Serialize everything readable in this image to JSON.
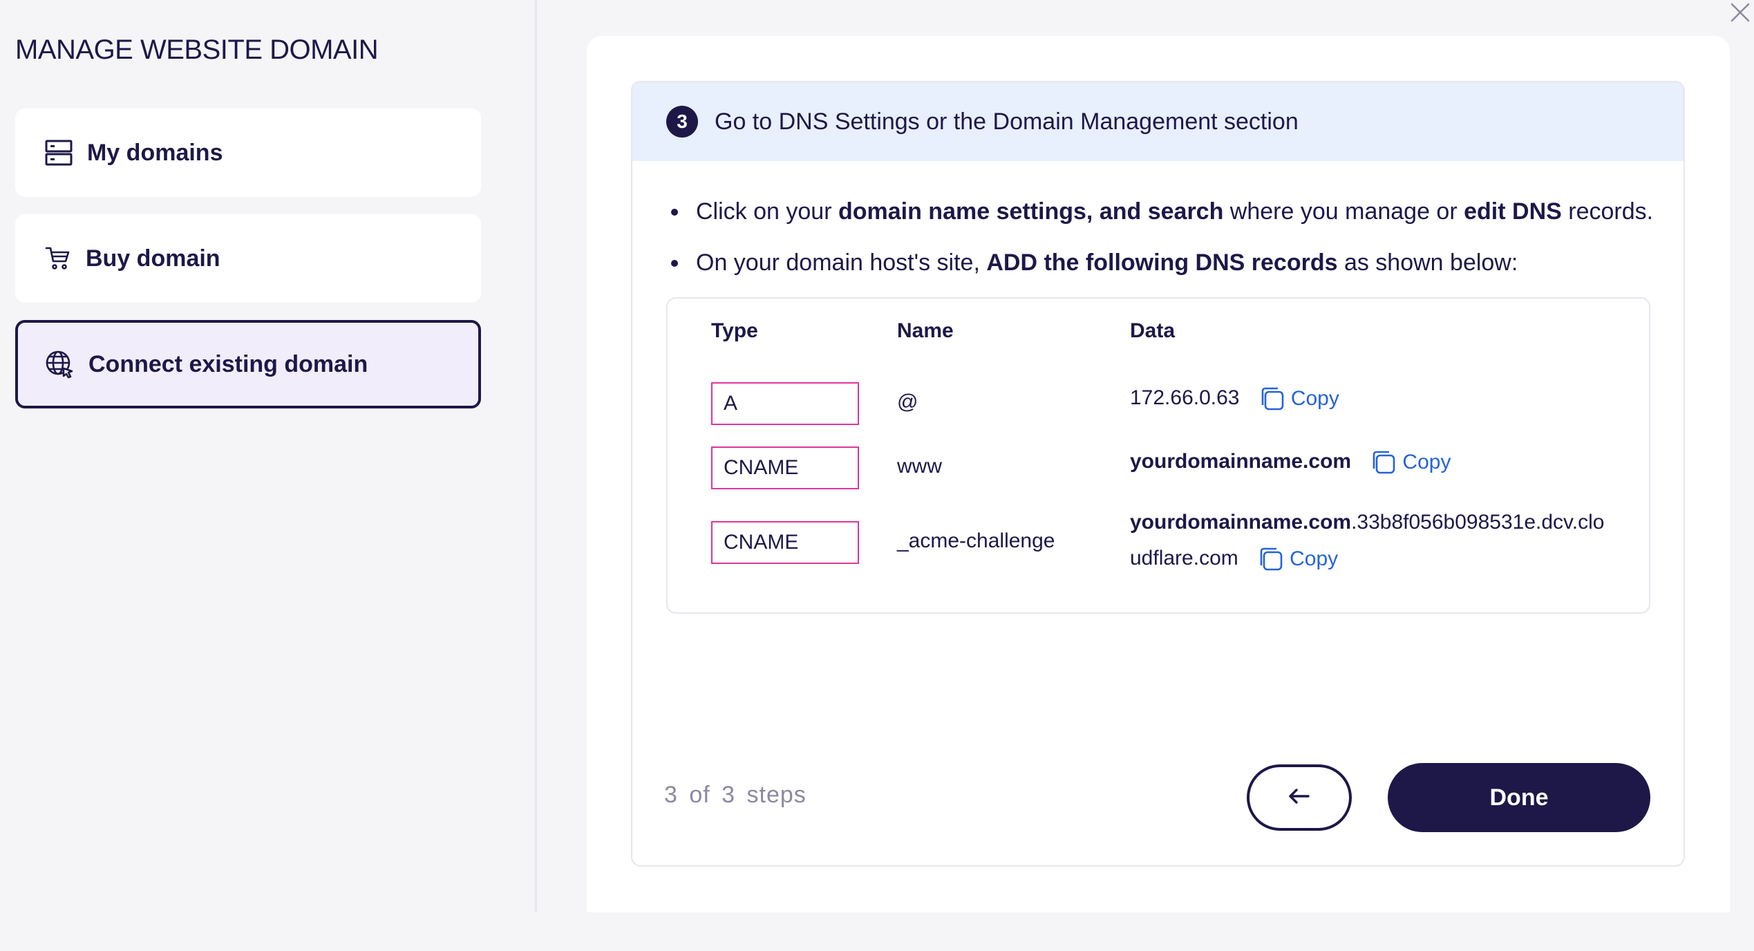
{
  "sidebar": {
    "title": "MANAGE WEBSITE DOMAIN",
    "items": [
      {
        "label": "My domains",
        "icon": "server-icon"
      },
      {
        "label": "Buy domain",
        "icon": "cart-icon"
      },
      {
        "label": "Connect existing domain",
        "icon": "globe-cursor-icon",
        "active": true
      }
    ]
  },
  "step": {
    "number": "3",
    "title": "Go to DNS Settings or the Domain Management section",
    "bullet1": {
      "t1": "Click on your ",
      "b1": "domain name settings, and search",
      "t2": " where you manage or ",
      "b2": "edit DNS",
      "t3": " records."
    },
    "bullet2": {
      "t1": "On your domain host's site, ",
      "b1": "ADD the following DNS records",
      "t2": " as shown below:"
    }
  },
  "records": {
    "headers": {
      "type": "Type",
      "name": "Name",
      "data": "Data"
    },
    "rows": [
      {
        "type": "A",
        "name": "@",
        "data": "172.66.0.63"
      },
      {
        "type": "CNAME",
        "name": "www",
        "data_bold": "yourdomainname.com"
      },
      {
        "type": "CNAME",
        "name": "_acme-challenge",
        "data_bold": "yourdomainname.com",
        "data_line1_rest": ".33b8f056b098531e.dcv.clo",
        "data_line2": "udflare.com"
      }
    ],
    "copy_label": "Copy"
  },
  "footer": {
    "steps_text": "3 of 3 steps",
    "done_label": "Done"
  },
  "colors": {
    "primary": "#1d1848",
    "link": "#2563d8",
    "type_border": "#e0359a",
    "header_bg": "#e8effd",
    "active_bg": "#f2edfb"
  }
}
